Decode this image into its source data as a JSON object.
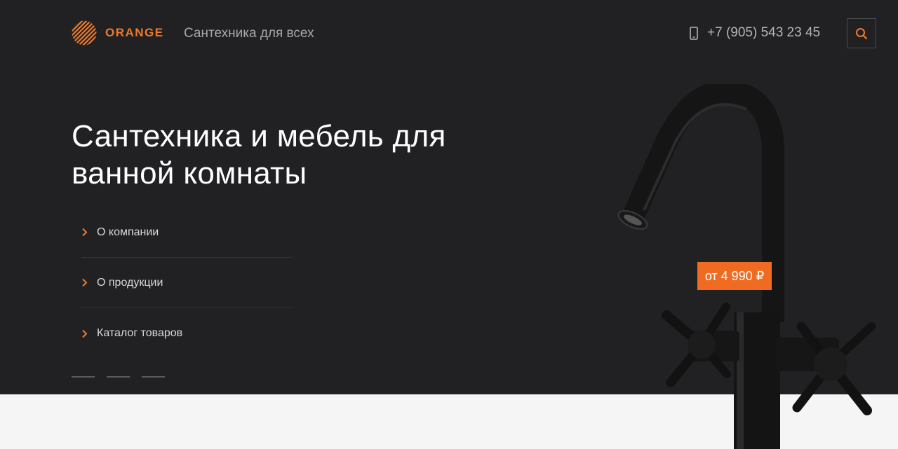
{
  "header": {
    "logo_text": "ORANGE",
    "tagline": "Сантехника для всех",
    "phone": "+7 (905) 543 23 45"
  },
  "hero": {
    "title": "Сантехника и мебель для ванной комнаты",
    "price_badge": "от 4 990 ₽"
  },
  "menu": {
    "items": [
      {
        "label": "О компании"
      },
      {
        "label": "О продукции"
      },
      {
        "label": "Каталог товаров"
      }
    ]
  },
  "slider": {
    "slide_count": 3
  },
  "colors": {
    "accent": "#ef7a2c",
    "hero_background": "#212123",
    "page_background": "#f5f5f5"
  },
  "icons": {
    "logo": "orange-stripes-logo-icon",
    "phone": "mobile-phone-icon",
    "search": "search-icon",
    "menu_bullet": "chevron-right-icon"
  }
}
